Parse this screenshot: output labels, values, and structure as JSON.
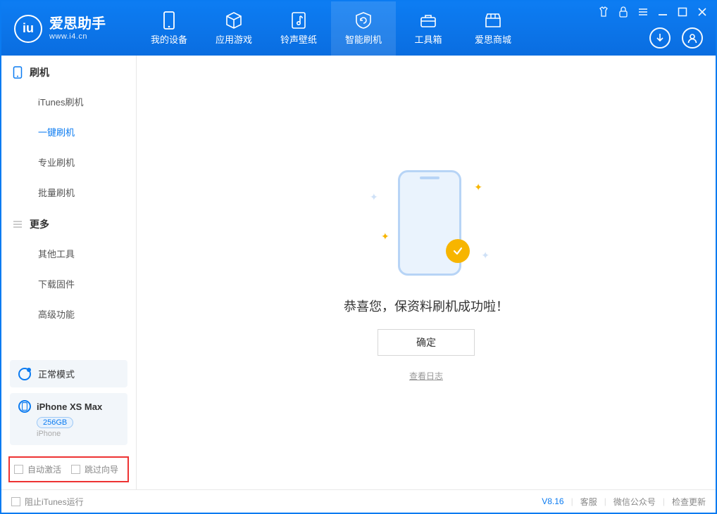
{
  "brand": {
    "title": "爱思助手",
    "subtitle": "www.i4.cn"
  },
  "nav": {
    "items": [
      {
        "label": "我的设备"
      },
      {
        "label": "应用游戏"
      },
      {
        "label": "铃声壁纸"
      },
      {
        "label": "智能刷机"
      },
      {
        "label": "工具箱"
      },
      {
        "label": "爱思商城"
      }
    ]
  },
  "sidebar": {
    "section1": {
      "title": "刷机",
      "items": [
        "iTunes刷机",
        "一键刷机",
        "专业刷机",
        "批量刷机"
      ]
    },
    "section2": {
      "title": "更多",
      "items": [
        "其他工具",
        "下载固件",
        "高级功能"
      ]
    },
    "mode_label": "正常模式",
    "device": {
      "name": "iPhone XS Max",
      "capacity": "256GB",
      "type": "iPhone"
    },
    "options": {
      "auto_activate": "自动激活",
      "skip_guide": "跳过向导"
    }
  },
  "main": {
    "message": "恭喜您，保资料刷机成功啦！",
    "ok_label": "确定",
    "log_link": "查看日志"
  },
  "status": {
    "block_itunes": "阻止iTunes运行",
    "version": "V8.16",
    "links": [
      "客服",
      "微信公众号",
      "检查更新"
    ]
  }
}
